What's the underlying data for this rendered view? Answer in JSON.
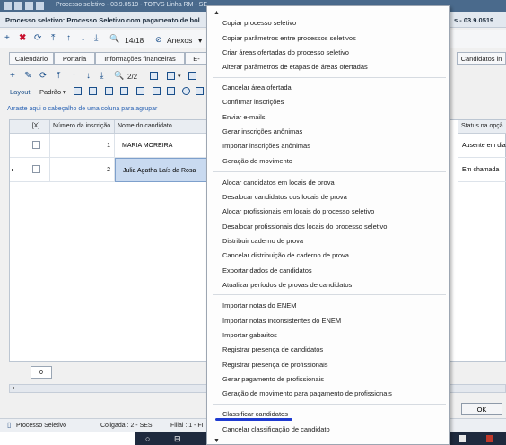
{
  "window": {
    "title": "Processo seletivo - 03.9.0519 - TOTVS Linha RM - SE",
    "process_title_left": "Processo seletivo: Processo Seletivo com pagamento de bol",
    "process_title_right": "s - 03.9.0519"
  },
  "toolbar": {
    "add": "+",
    "delete": "✖",
    "refresh": "⟳",
    "first": "⤒",
    "up": "↑",
    "down": "↓",
    "last": "⤓",
    "search": "🔍",
    "record_counter": "14/18",
    "attachments_label": "Anexos",
    "attachments_caret": "▾"
  },
  "tabs": [
    {
      "label": "Calendário"
    },
    {
      "label": "Portaria"
    },
    {
      "label": "Informações financeiras"
    },
    {
      "label": "E-"
    },
    {
      "label": "Candidatos in"
    }
  ],
  "grid_toolbar": {
    "page_counter": "2/2",
    "layout_label": "Layout:",
    "layout_value": "Padrão",
    "layout_caret": "▾"
  },
  "group_hint": "Arraste aqui o cabeçalho de uma coluna para agrupar",
  "grid": {
    "headers": {
      "check": "[X]",
      "inscricao": "Número da inscrição",
      "candidato": "Nome do candidato",
      "status": "Status na opçã"
    },
    "rows": [
      {
        "inscricao": "1",
        "candidato": "MARIA MOREIRA",
        "status": "Ausente em dia"
      },
      {
        "inscricao": "2",
        "candidato": "Julia Agatha Laís da Rosa",
        "status": "Em chamada"
      }
    ],
    "row_count": "0"
  },
  "ok_button": "OK",
  "statusbar": {
    "process": "Processo Seletivo",
    "coligada": "Coligada : 2 - SESI",
    "filial": "Filial : 1 - FI"
  },
  "menu": {
    "items": [
      "Copiar processo seletivo",
      "Copiar parâmetros entre processos seletivos",
      "Criar áreas ofertadas do processo seletivo",
      "Alterar parâmetros de etapas de áreas ofertadas",
      "Cancelar área ofertada",
      "Confirmar inscrições",
      "Enviar e-mails",
      "Gerar inscrições anônimas",
      "Importar inscrições anônimas",
      "Geração de movimento",
      "Alocar candidatos em locais de prova",
      "Desalocar candidatos dos locais de prova",
      "Alocar profissionais em locais do processo seletivo",
      "Desalocar profissionais dos locais do processo seletivo",
      "Distribuir caderno de prova",
      "Cancelar distribuição de caderno de prova",
      "Exportar dados de candidatos",
      "Atualizar períodos de provas de candidatos",
      "Importar notas do ENEM",
      "Importar notas inconsistentes do ENEM",
      "Importar gabaritos",
      "Registrar presença de candidatos",
      "Registrar presença de profissionais",
      "Gerar pagamento de profissionais",
      "Geração de movimento para pagamento de profissionais",
      "Classificar candidatos",
      "Cancelar classificação de candidato"
    ],
    "scroll_up": "▲",
    "scroll_down": "▼"
  },
  "colors": {
    "accent_blue": "#1a4f8a",
    "delete_red": "#c8102e",
    "highlight_underline": "#1f3bd0",
    "selected_row": "#c9daf0"
  }
}
